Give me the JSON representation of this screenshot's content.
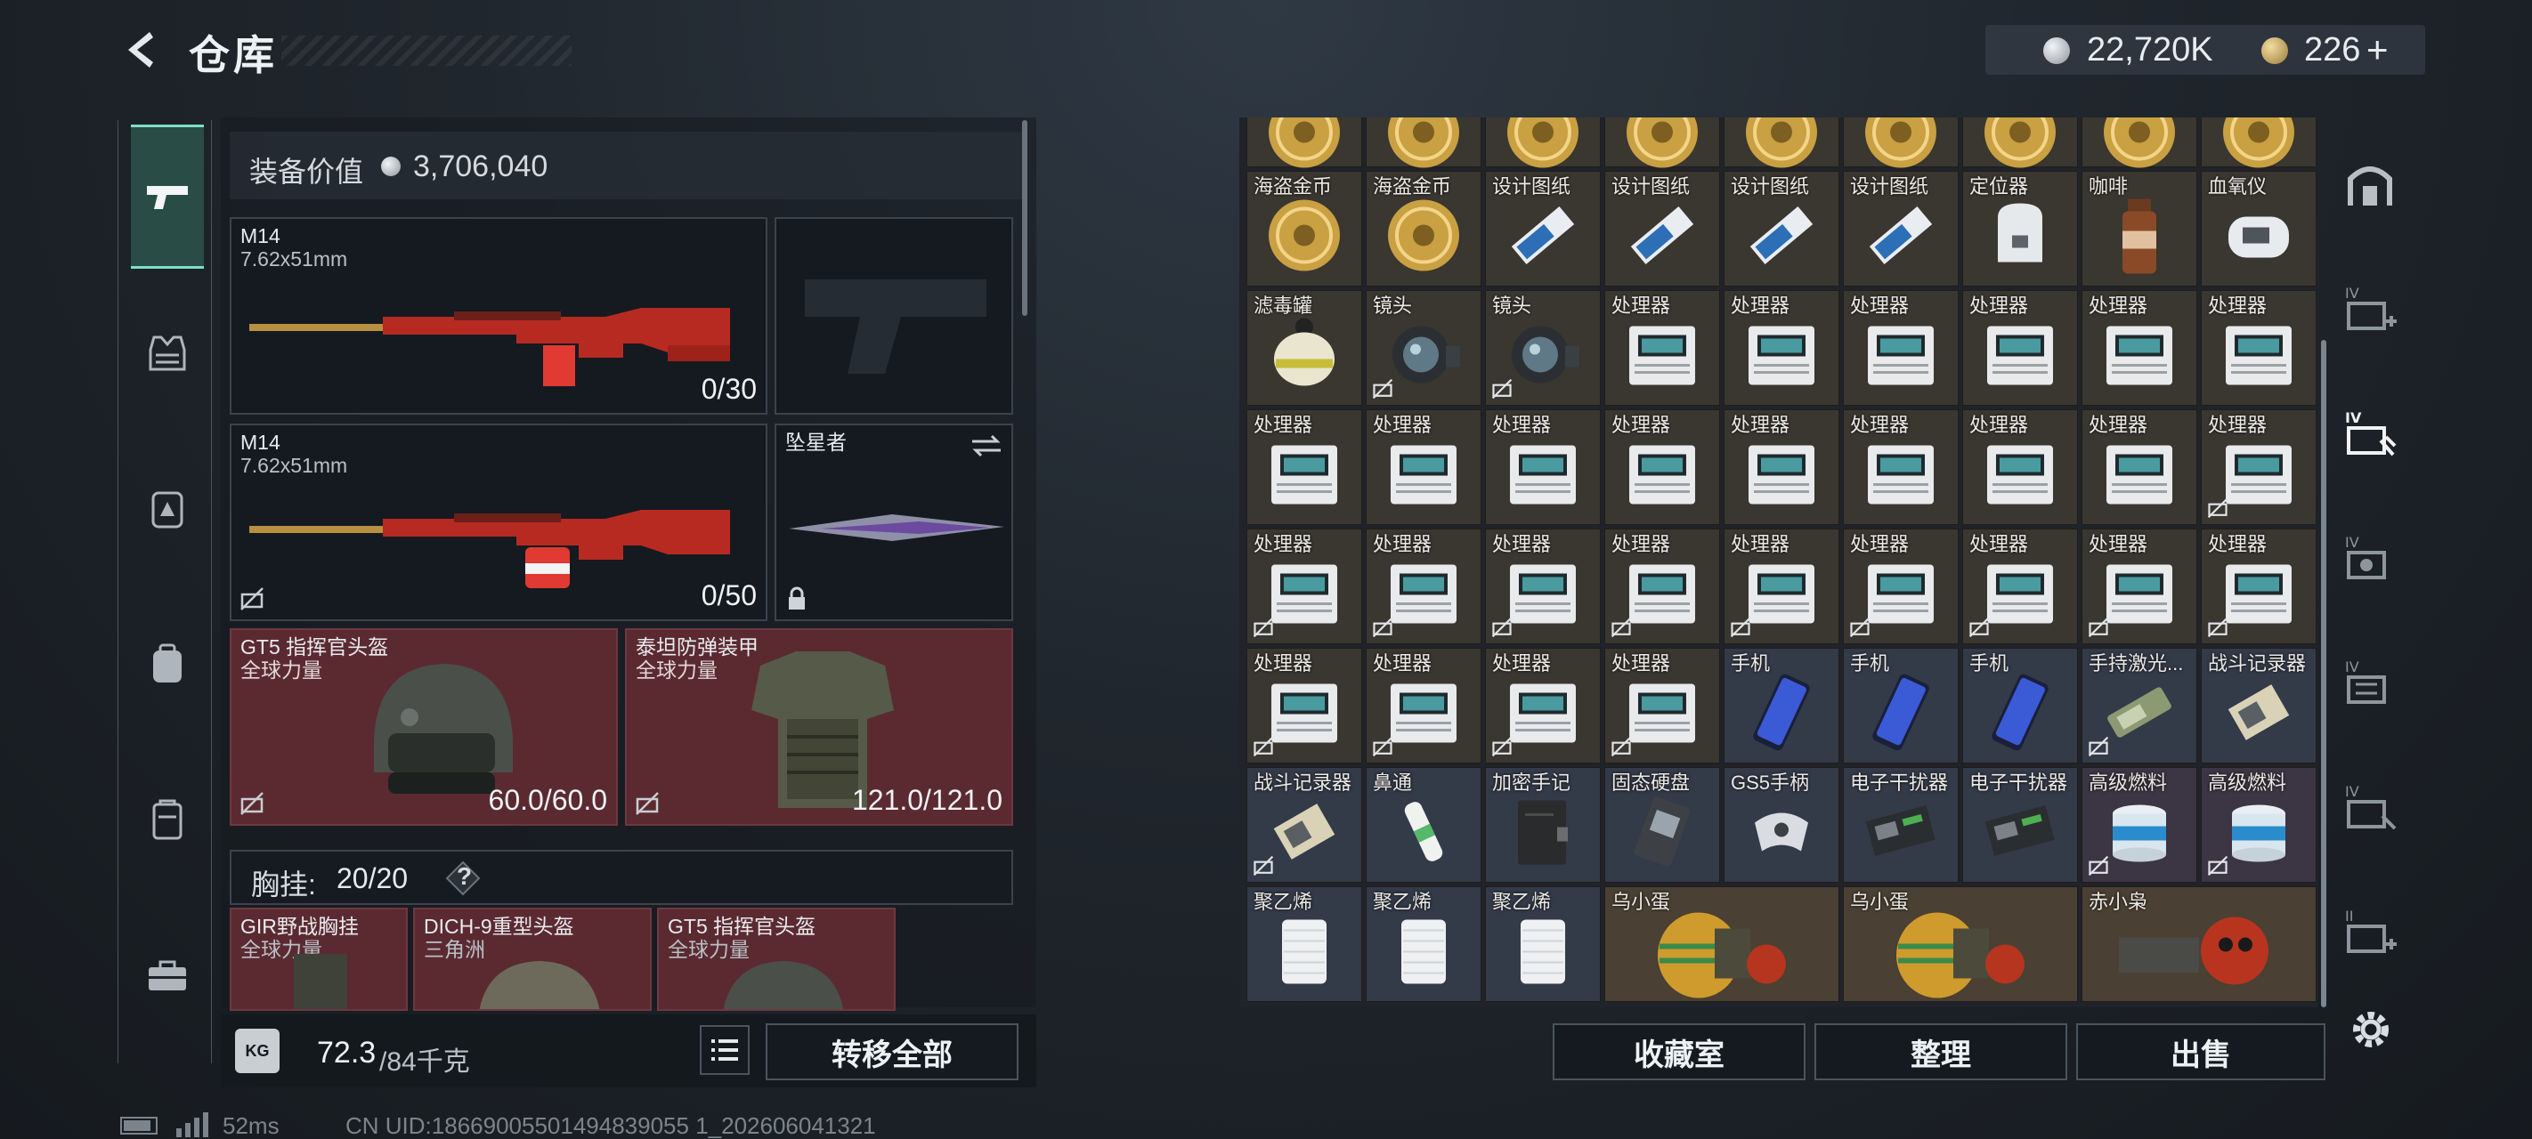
{
  "header": {
    "title": "仓库"
  },
  "currency": {
    "silver": "22,720K",
    "gold": "226",
    "gold_add": "+"
  },
  "side_tabs": [
    {
      "icon": "pistol-icon",
      "active": true
    },
    {
      "icon": "vest-icon"
    },
    {
      "icon": "backpack-alert-icon"
    },
    {
      "icon": "backpack-icon"
    },
    {
      "icon": "case-icon"
    },
    {
      "icon": "toolbox-icon"
    }
  ],
  "equipment": {
    "value_label": "装备价值",
    "value": "3,706,040",
    "primary1": {
      "name": "M14",
      "caliber": "7.62x51mm",
      "ammo": "0/30"
    },
    "primary2": {
      "name": "M14",
      "caliber": "7.62x51mm",
      "ammo": "0/50"
    },
    "melee": {
      "name": "坠星者"
    },
    "helmet": {
      "name": "GT5 指挥官头盔",
      "brand": "全球力量",
      "durability": "60.0/60.0"
    },
    "armor": {
      "name": "泰坦防弹装甲",
      "brand": "全球力量",
      "durability": "121.0/121.0"
    },
    "chest": {
      "label": "胸挂:",
      "value": "20/20",
      "help": "?"
    },
    "chest_items": [
      {
        "name": "GIR野战胸挂",
        "brand": "全球力量"
      },
      {
        "name": "DICH-9重型头盔",
        "brand": "三角洲"
      },
      {
        "name": "GT5 指挥官头盔",
        "brand": "全球力量"
      }
    ],
    "weight": {
      "current": "72.3",
      "max": "/84千克",
      "kg_icon": "KG"
    },
    "transfer_all": "转移全部"
  },
  "grid": {
    "rows": [
      [
        {
          "name": "海盗金币",
          "icon": "coin"
        },
        {
          "name": "海盗金币",
          "icon": "coin"
        },
        {
          "name": "设计图纸",
          "icon": "blueprint"
        },
        {
          "name": "设计图纸",
          "icon": "blueprint"
        },
        {
          "name": "设计图纸",
          "icon": "blueprint"
        },
        {
          "name": "设计图纸",
          "icon": "blueprint"
        },
        {
          "name": "定位器",
          "icon": "locator"
        },
        {
          "name": "咖啡",
          "icon": "coffee"
        },
        {
          "name": "血氧仪",
          "icon": "oximeter"
        }
      ],
      [
        {
          "name": "滤毒罐",
          "icon": "canister"
        },
        {
          "name": "镜头",
          "icon": "lens",
          "nopawn": true
        },
        {
          "name": "镜头",
          "icon": "lens",
          "nopawn": true
        },
        {
          "name": "处理器",
          "icon": "processor"
        },
        {
          "name": "处理器",
          "icon": "processor"
        },
        {
          "name": "处理器",
          "icon": "processor"
        },
        {
          "name": "处理器",
          "icon": "processor"
        },
        {
          "name": "处理器",
          "icon": "processor"
        },
        {
          "name": "处理器",
          "icon": "processor"
        }
      ],
      [
        {
          "name": "处理器",
          "icon": "processor"
        },
        {
          "name": "处理器",
          "icon": "processor"
        },
        {
          "name": "处理器",
          "icon": "processor"
        },
        {
          "name": "处理器",
          "icon": "processor"
        },
        {
          "name": "处理器",
          "icon": "processor"
        },
        {
          "name": "处理器",
          "icon": "processor"
        },
        {
          "name": "处理器",
          "icon": "processor"
        },
        {
          "name": "处理器",
          "icon": "processor"
        },
        {
          "name": "处理器",
          "icon": "processor",
          "nopawn": true
        }
      ],
      [
        {
          "name": "处理器",
          "icon": "processor",
          "nopawn": true
        },
        {
          "name": "处理器",
          "icon": "processor",
          "nopawn": true
        },
        {
          "name": "处理器",
          "icon": "processor",
          "nopawn": true
        },
        {
          "name": "处理器",
          "icon": "processor",
          "nopawn": true
        },
        {
          "name": "处理器",
          "icon": "processor",
          "nopawn": true
        },
        {
          "name": "处理器",
          "icon": "processor",
          "nopawn": true
        },
        {
          "name": "处理器",
          "icon": "processor",
          "nopawn": true
        },
        {
          "name": "处理器",
          "icon": "processor",
          "nopawn": true
        },
        {
          "name": "处理器",
          "icon": "processor",
          "nopawn": true
        }
      ],
      [
        {
          "name": "处理器",
          "icon": "processor",
          "nopawn": true
        },
        {
          "name": "处理器",
          "icon": "processor",
          "nopawn": true
        },
        {
          "name": "处理器",
          "icon": "processor",
          "nopawn": true
        },
        {
          "name": "处理器",
          "icon": "processor",
          "nopawn": true
        },
        {
          "name": "手机",
          "icon": "phone",
          "tint": "blue"
        },
        {
          "name": "手机",
          "icon": "phone",
          "tint": "blue"
        },
        {
          "name": "手机",
          "icon": "phone",
          "tint": "blue"
        },
        {
          "name": "手持激光...",
          "icon": "laser",
          "tint": "blue",
          "nopawn": true
        },
        {
          "name": "战斗记录器",
          "icon": "recorder",
          "tint": "blue"
        }
      ],
      [
        {
          "name": "战斗记录器",
          "icon": "recorder",
          "tint": "blue",
          "nopawn": true
        },
        {
          "name": "鼻通",
          "icon": "inhaler",
          "tint": "blue"
        },
        {
          "name": "加密手记",
          "icon": "notebook",
          "tint": "blue"
        },
        {
          "name": "固态硬盘",
          "icon": "ssd",
          "tint": "blue"
        },
        {
          "name": "GS5手柄",
          "icon": "controller",
          "tint": "blue"
        },
        {
          "name": "电子干扰器",
          "icon": "jammer",
          "tint": "blue"
        },
        {
          "name": "电子干扰器",
          "icon": "jammer",
          "tint": "blue"
        },
        {
          "name": "高级燃料",
          "icon": "fuel",
          "tint": "purple",
          "nopawn": true
        },
        {
          "name": "高级燃料",
          "icon": "fuel",
          "tint": "purple",
          "nopawn": true
        }
      ],
      [
        {
          "name": "聚乙烯",
          "icon": "roll",
          "tint": "blue"
        },
        {
          "name": "聚乙烯",
          "icon": "roll",
          "tint": "blue"
        },
        {
          "name": "聚乙烯",
          "icon": "roll",
          "tint": "blue"
        },
        {
          "name": "乌小蛋",
          "icon": "egg",
          "wide": true
        },
        {
          "name": "乌小蛋",
          "icon": "egg",
          "wide": true
        },
        {
          "name": "赤小枭",
          "icon": "owl",
          "wide": true
        }
      ]
    ]
  },
  "bottom_buttons": [
    "收藏室",
    "整理",
    "出售"
  ],
  "status": {
    "ping": "52ms",
    "uid": "CN UID:18669005501494839055 1_202606041321"
  },
  "colors": {
    "accent": "#7de0c5",
    "red_slot": "#5b2a31",
    "grid_gold": "#3a3630",
    "grid_blue": "#333a48",
    "grid_purple": "#3c3543"
  }
}
